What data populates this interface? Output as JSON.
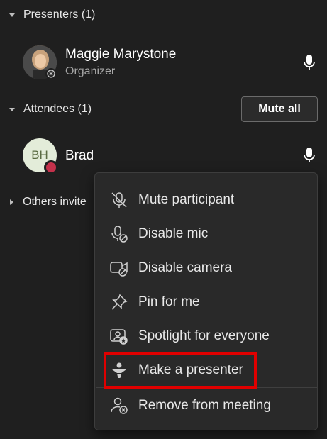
{
  "presenters": {
    "header": "Presenters (1)",
    "participants": [
      {
        "name": "Maggie Marystone",
        "role": "Organizer",
        "icon": "microphone-icon"
      }
    ]
  },
  "attendees": {
    "header": "Attendees (1)",
    "mute_all_label": "Mute all",
    "participants": [
      {
        "name": "Brad",
        "initials": "BH",
        "icon": "microphone-icon",
        "status_color": "#c4314b"
      }
    ]
  },
  "others_invited": {
    "header": "Others invite"
  },
  "context_menu": {
    "items": [
      {
        "label": "Mute participant",
        "icon": "mic-off-icon"
      },
      {
        "label": "Disable mic",
        "icon": "mic-disabled-icon"
      },
      {
        "label": "Disable camera",
        "icon": "camera-disabled-icon"
      },
      {
        "label": "Pin for me",
        "icon": "pin-icon"
      },
      {
        "label": "Spotlight for everyone",
        "icon": "spotlight-icon"
      },
      {
        "label": "Make a presenter",
        "icon": "presenter-icon",
        "highlighted": true
      },
      {
        "label": "Remove from meeting",
        "icon": "remove-person-icon"
      }
    ]
  },
  "colors": {
    "background": "#1f1f1f",
    "menu_background": "#292929",
    "highlight_border": "#e00000",
    "avatar_initials_bg": "#e3ecd9",
    "status_busy": "#c4314b"
  }
}
